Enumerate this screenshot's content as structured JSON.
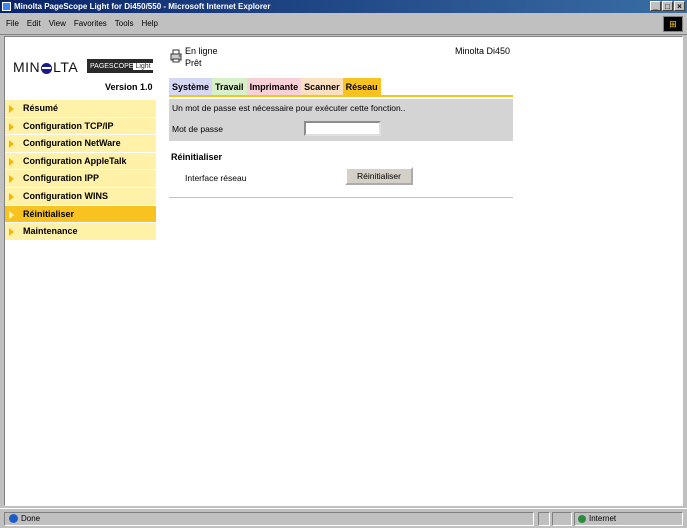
{
  "window": {
    "title": "Minolta PageScope Light for Di450/550 - Microsoft Internet Explorer",
    "buttons": [
      "_",
      "□",
      "×"
    ]
  },
  "menu": [
    "File",
    "Edit",
    "View",
    "Favorites",
    "Tools",
    "Help"
  ],
  "logo": {
    "brand_pre": "MIN",
    "brand_post": "LTA",
    "badge": "PAGESCOPE",
    "badge_light": "Light",
    "version": "Version 1.0"
  },
  "nav": {
    "items": [
      {
        "label": "Résumé"
      },
      {
        "label": "Configuration TCP/IP"
      },
      {
        "label": "Configuration NetWare"
      },
      {
        "label": "Configuration AppleTalk"
      },
      {
        "label": "Configuration IPP"
      },
      {
        "label": "Configuration WINS"
      },
      {
        "label": "Réinitialiser"
      },
      {
        "label": "Maintenance"
      }
    ],
    "active_index": 6
  },
  "status": {
    "line1": "En ligne",
    "line2": "Prêt",
    "device": "Minolta Di450"
  },
  "tabs": [
    "Système",
    "Travail",
    "Imprimante",
    "Scanner",
    "Réseau"
  ],
  "password": {
    "message": "Un mot de passe est nécessaire pour exécuter cette fonction..",
    "label": "Mot de passe",
    "value": ""
  },
  "reset": {
    "title": "Réinitialiser",
    "interface_label": "Interface réseau",
    "button": "Réinitialiser"
  },
  "statusbar": {
    "done": "Done",
    "zone": "Internet"
  },
  "colors": {
    "nav_bg": "#fff2a8",
    "nav_active": "#f8c320",
    "accent": "#f8c320"
  }
}
